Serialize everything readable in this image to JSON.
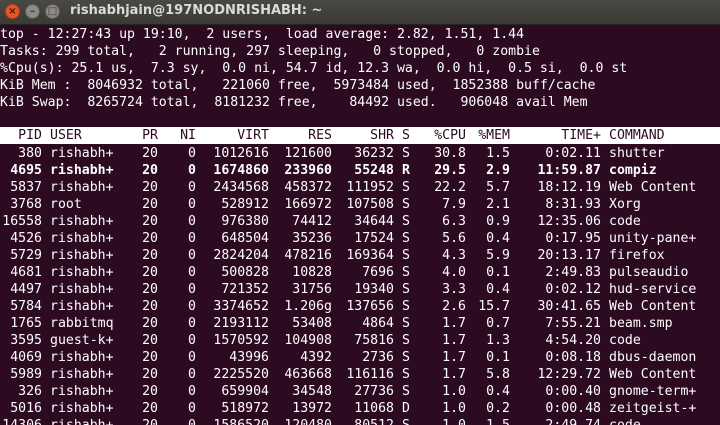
{
  "window": {
    "title": "rishabhjain@197NODNRISHABH: ~",
    "buttons": {
      "close": "×",
      "minimize": "–",
      "maximize": "□"
    }
  },
  "summary": [
    "top - 12:27:43 up 19:10,  2 users,  load average: 2.82, 1.51, 1.44",
    "Tasks: 299 total,   2 running, 297 sleeping,   0 stopped,   0 zombie",
    "%Cpu(s): 25.1 us,  7.3 sy,  0.0 ni, 54.7 id, 12.3 wa,  0.0 hi,  0.5 si,  0.0 st",
    "KiB Mem :  8046932 total,   221060 free,  5973484 used,  1852388 buff/cache",
    "KiB Swap:  8265724 total,  8181232 free,    84492 used.   906048 avail Mem"
  ],
  "columns": [
    "PID",
    "USER",
    "PR",
    "NI",
    "VIRT",
    "RES",
    "SHR",
    "S",
    "%CPU",
    "%MEM",
    "TIME+",
    "COMMAND"
  ],
  "processes": [
    {
      "pid": "380",
      "user": "rishabh+",
      "pr": "20",
      "ni": "0",
      "virt": "1012616",
      "res": "121600",
      "shr": "36232",
      "s": "S",
      "cpu": "30.8",
      "mem": "1.5",
      "time": "0:02.11",
      "cmd": "shutter",
      "bold": false
    },
    {
      "pid": "4695",
      "user": "rishabh+",
      "pr": "20",
      "ni": "0",
      "virt": "1674860",
      "res": "233960",
      "shr": "55248",
      "s": "R",
      "cpu": "29.5",
      "mem": "2.9",
      "time": "11:59.87",
      "cmd": "compiz",
      "bold": true
    },
    {
      "pid": "5837",
      "user": "rishabh+",
      "pr": "20",
      "ni": "0",
      "virt": "2434568",
      "res": "458372",
      "shr": "111952",
      "s": "S",
      "cpu": "22.2",
      "mem": "5.7",
      "time": "18:12.19",
      "cmd": "Web Content",
      "bold": false
    },
    {
      "pid": "3768",
      "user": "root",
      "pr": "20",
      "ni": "0",
      "virt": "528912",
      "res": "166972",
      "shr": "107508",
      "s": "S",
      "cpu": "7.9",
      "mem": "2.1",
      "time": "8:31.93",
      "cmd": "Xorg",
      "bold": false
    },
    {
      "pid": "16558",
      "user": "rishabh+",
      "pr": "20",
      "ni": "0",
      "virt": "976380",
      "res": "74412",
      "shr": "34644",
      "s": "S",
      "cpu": "6.3",
      "mem": "0.9",
      "time": "12:35.06",
      "cmd": "code",
      "bold": false
    },
    {
      "pid": "4526",
      "user": "rishabh+",
      "pr": "20",
      "ni": "0",
      "virt": "648504",
      "res": "35236",
      "shr": "17524",
      "s": "S",
      "cpu": "5.6",
      "mem": "0.4",
      "time": "0:17.95",
      "cmd": "unity-pane+",
      "bold": false
    },
    {
      "pid": "5729",
      "user": "rishabh+",
      "pr": "20",
      "ni": "0",
      "virt": "2824204",
      "res": "478216",
      "shr": "169364",
      "s": "S",
      "cpu": "4.3",
      "mem": "5.9",
      "time": "20:13.17",
      "cmd": "firefox",
      "bold": false
    },
    {
      "pid": "4681",
      "user": "rishabh+",
      "pr": "20",
      "ni": "0",
      "virt": "500828",
      "res": "10828",
      "shr": "7696",
      "s": "S",
      "cpu": "4.0",
      "mem": "0.1",
      "time": "2:49.83",
      "cmd": "pulseaudio",
      "bold": false
    },
    {
      "pid": "4497",
      "user": "rishabh+",
      "pr": "20",
      "ni": "0",
      "virt": "721352",
      "res": "31756",
      "shr": "19340",
      "s": "S",
      "cpu": "3.3",
      "mem": "0.4",
      "time": "0:02.12",
      "cmd": "hud-service",
      "bold": false
    },
    {
      "pid": "5784",
      "user": "rishabh+",
      "pr": "20",
      "ni": "0",
      "virt": "3374652",
      "res": "1.206g",
      "shr": "137656",
      "s": "S",
      "cpu": "2.6",
      "mem": "15.7",
      "time": "30:41.65",
      "cmd": "Web Content",
      "bold": false
    },
    {
      "pid": "1765",
      "user": "rabbitmq",
      "pr": "20",
      "ni": "0",
      "virt": "2193112",
      "res": "53408",
      "shr": "4864",
      "s": "S",
      "cpu": "1.7",
      "mem": "0.7",
      "time": "7:55.21",
      "cmd": "beam.smp",
      "bold": false
    },
    {
      "pid": "3595",
      "user": "guest-k+",
      "pr": "20",
      "ni": "0",
      "virt": "1570592",
      "res": "104908",
      "shr": "75816",
      "s": "S",
      "cpu": "1.7",
      "mem": "1.3",
      "time": "4:54.20",
      "cmd": "code",
      "bold": false
    },
    {
      "pid": "4069",
      "user": "rishabh+",
      "pr": "20",
      "ni": "0",
      "virt": "43996",
      "res": "4392",
      "shr": "2736",
      "s": "S",
      "cpu": "1.7",
      "mem": "0.1",
      "time": "0:08.18",
      "cmd": "dbus-daemon",
      "bold": false
    },
    {
      "pid": "5989",
      "user": "rishabh+",
      "pr": "20",
      "ni": "0",
      "virt": "2225520",
      "res": "463668",
      "shr": "116116",
      "s": "S",
      "cpu": "1.7",
      "mem": "5.8",
      "time": "12:29.72",
      "cmd": "Web Content",
      "bold": false
    },
    {
      "pid": "326",
      "user": "rishabh+",
      "pr": "20",
      "ni": "0",
      "virt": "659904",
      "res": "34548",
      "shr": "27736",
      "s": "S",
      "cpu": "1.0",
      "mem": "0.4",
      "time": "0:00.40",
      "cmd": "gnome-term+",
      "bold": false
    },
    {
      "pid": "5016",
      "user": "rishabh+",
      "pr": "20",
      "ni": "0",
      "virt": "518972",
      "res": "13972",
      "shr": "11068",
      "s": "D",
      "cpu": "1.0",
      "mem": "0.2",
      "time": "0:00.48",
      "cmd": "zeitgeist-+",
      "bold": false
    },
    {
      "pid": "14306",
      "user": "rishabh+",
      "pr": "20",
      "ni": "0",
      "virt": "1586520",
      "res": "120480",
      "shr": "80512",
      "s": "S",
      "cpu": "1.0",
      "mem": "1.5",
      "time": "2:49.74",
      "cmd": "code",
      "bold": false
    }
  ]
}
